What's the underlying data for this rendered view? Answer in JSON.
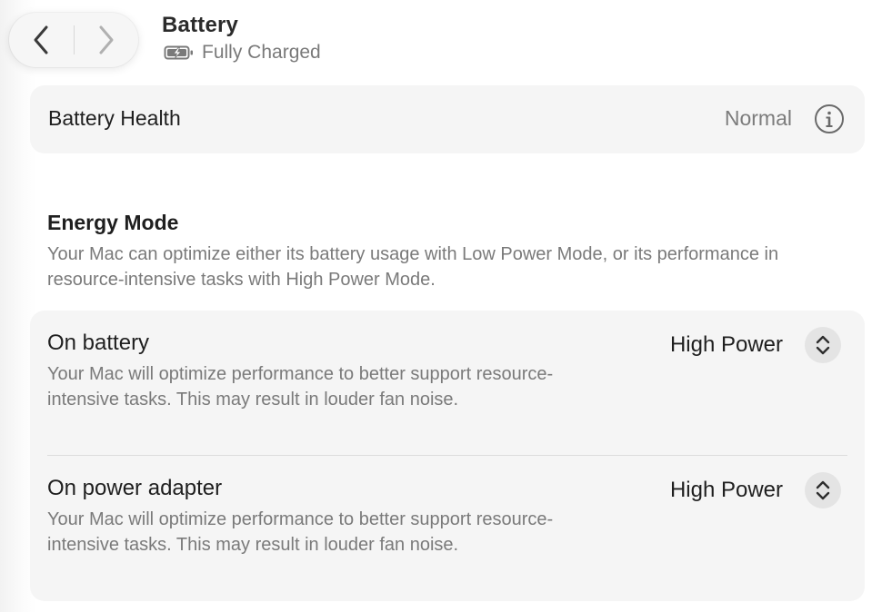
{
  "header": {
    "title": "Battery",
    "status": "Fully Charged",
    "status_icon": "battery-charged-icon",
    "back_icon": "chevron-left-icon",
    "forward_icon": "chevron-right-icon"
  },
  "battery_health": {
    "label": "Battery Health",
    "value": "Normal",
    "info_icon": "info-icon"
  },
  "energy_mode": {
    "heading": "Energy Mode",
    "description": "Your Mac can optimize either its battery usage with Low Power Mode, or its performance in resource-intensive tasks with High Power Mode.",
    "rows": [
      {
        "label": "On battery",
        "description": "Your Mac will optimize performance to better support resource-intensive tasks. This may result in louder fan noise.",
        "selected": "High Power"
      },
      {
        "label": "On power adapter",
        "description": "Your Mac will optimize performance to better support resource-intensive tasks. This may result in louder fan noise.",
        "selected": "High Power"
      }
    ]
  },
  "colors": {
    "card_background": "#f5f5f5",
    "secondary_text": "#7a7a7a",
    "primary_text": "#1f1f1f"
  }
}
